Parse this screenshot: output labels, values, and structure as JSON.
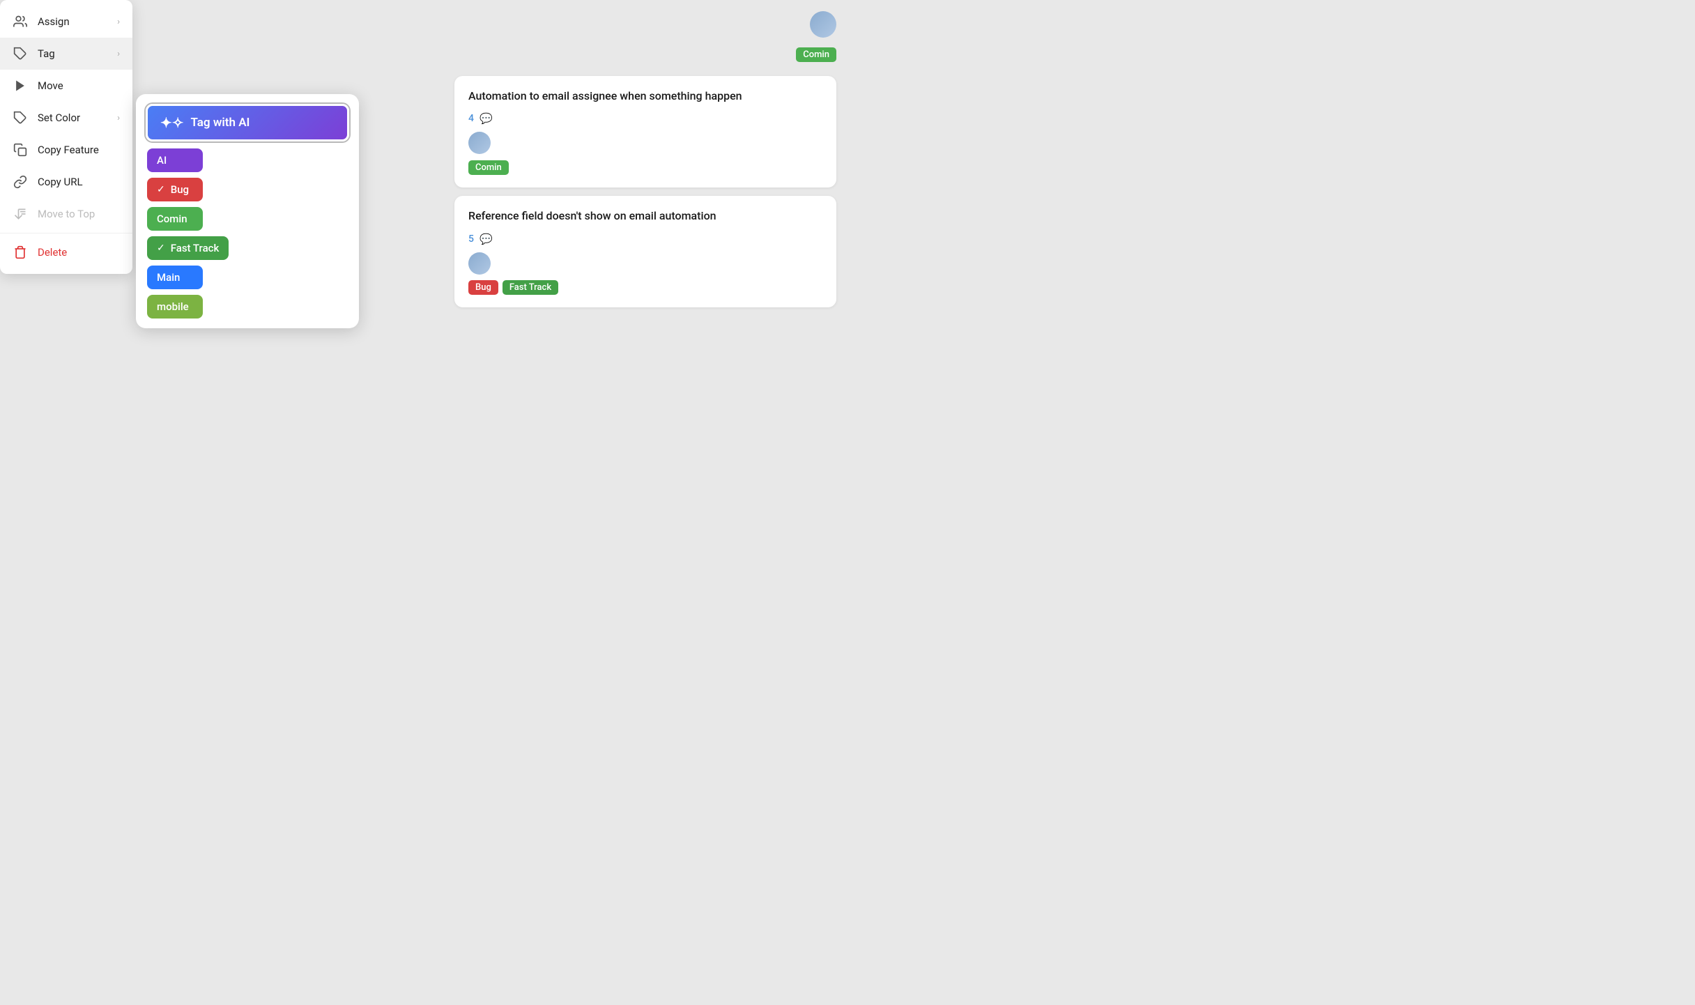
{
  "menu": {
    "items": [
      {
        "id": "assign",
        "label": "Assign",
        "icon": "👥",
        "hasChevron": true
      },
      {
        "id": "tag",
        "label": "Tag",
        "icon": "🏷",
        "hasChevron": true
      },
      {
        "id": "move",
        "label": "Move",
        "icon": "➤",
        "hasChevron": false
      },
      {
        "id": "set-color",
        "label": "Set Color",
        "icon": "🏷",
        "hasChevron": true
      },
      {
        "id": "copy-feature",
        "label": "Copy Feature",
        "icon": "📋",
        "hasChevron": false
      },
      {
        "id": "copy-url",
        "label": "Copy URL",
        "icon": "🔗",
        "hasChevron": false
      },
      {
        "id": "move-to-top",
        "label": "Move to Top",
        "icon": "↩",
        "hasChevron": false,
        "disabled": true
      },
      {
        "id": "delete",
        "label": "Delete",
        "icon": "🗑",
        "hasChevron": false,
        "danger": true
      }
    ]
  },
  "tagSubmenu": {
    "aiButton": {
      "label": "Tag with AI",
      "icon": "✦"
    },
    "tags": [
      {
        "id": "ai",
        "label": "AI",
        "colorClass": "ai-tag",
        "checked": false
      },
      {
        "id": "bug",
        "label": "Bug",
        "colorClass": "bug-tag",
        "checked": true
      },
      {
        "id": "comin",
        "label": "Comin",
        "colorClass": "comin-tag",
        "checked": false
      },
      {
        "id": "fasttrack",
        "label": "Fast Track",
        "colorClass": "fasttrack-tag",
        "checked": true
      },
      {
        "id": "main",
        "label": "Main",
        "colorClass": "main-tag",
        "checked": false
      },
      {
        "id": "mobile",
        "label": "mobile",
        "colorClass": "mobile-tag",
        "checked": false
      }
    ]
  },
  "cards": [
    {
      "id": "card1",
      "title": "Automation to email assignee when something happen",
      "commentCount": "4",
      "tags": [
        "Comin"
      ]
    },
    {
      "id": "card2",
      "title": "Reference field doesn't show on email automation",
      "commentCount": "5",
      "tags": [
        "Bug",
        "Fast Track"
      ]
    }
  ]
}
